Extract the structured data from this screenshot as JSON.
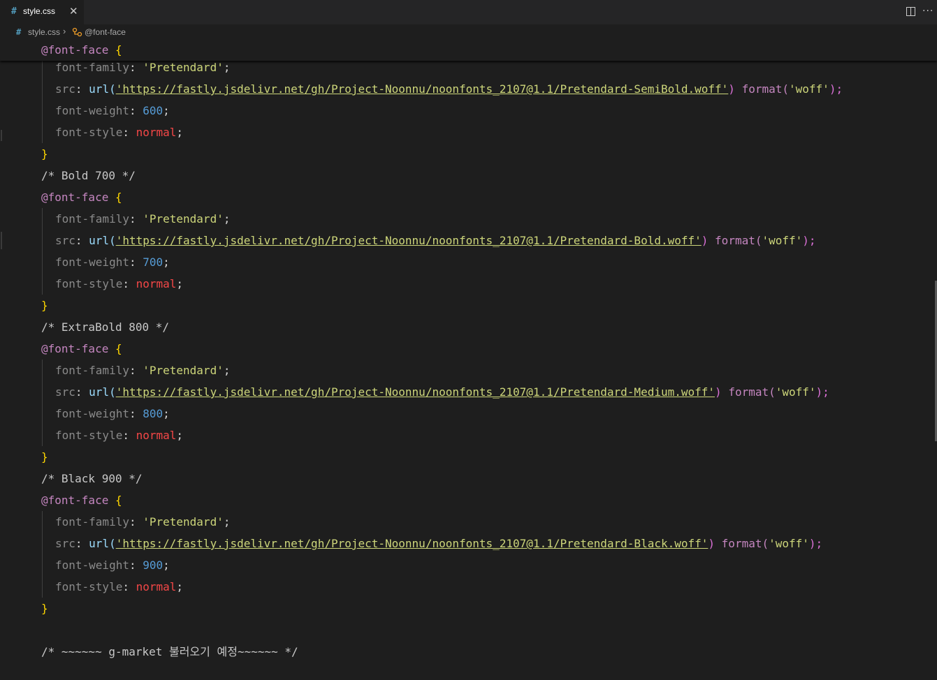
{
  "tab": {
    "icon": "#",
    "label": "style.css",
    "close": "✕"
  },
  "toolbar": {
    "split_icon": "split-editor-icon",
    "more": "···"
  },
  "breadcrumb": {
    "file_icon": "#",
    "file": "style.css",
    "separator": "›",
    "symbol": "@font-face"
  },
  "editor": {
    "sticky": {
      "at": "@font-face",
      "brace": "{"
    },
    "lines": [
      {
        "prop": "font-family",
        "value": "'Pretendard'"
      },
      {
        "prop": "src",
        "url_fn": "url(",
        "link": "'https://fastly.jsdelivr.net/gh/Project-Noonnu/noonfonts_2107@1.1/Pretendard-SemiBold.woff'",
        "close": ")",
        "fmt": "format(",
        "fmt_val": "'woff'",
        "fmt_close": ");"
      },
      {
        "prop": "font-weight",
        "value": "600"
      },
      {
        "prop": "font-style",
        "value": "normal"
      },
      {
        "close_brace": "}"
      },
      {
        "comment": "/* Bold 700 */"
      },
      {
        "at": "@font-face",
        "brace": "{"
      },
      {
        "prop": "font-family",
        "value": "'Pretendard'"
      },
      {
        "prop": "src",
        "url_fn": "url(",
        "link": "'https://fastly.jsdelivr.net/gh/Project-Noonnu/noonfonts_2107@1.1/Pretendard-Bold.woff'",
        "close": ")",
        "fmt": "format(",
        "fmt_val": "'woff'",
        "fmt_close": ");"
      },
      {
        "prop": "font-weight",
        "value": "700"
      },
      {
        "prop": "font-style",
        "value": "normal"
      },
      {
        "close_brace": "}"
      },
      {
        "comment": "/* ExtraBold 800 */"
      },
      {
        "at": "@font-face",
        "brace": "{"
      },
      {
        "prop": "font-family",
        "value": "'Pretendard'"
      },
      {
        "prop": "src",
        "url_fn": "url(",
        "link": "'https://fastly.jsdelivr.net/gh/Project-Noonnu/noonfonts_2107@1.1/Pretendard-Medium.woff'",
        "close": ")",
        "fmt": "format(",
        "fmt_val": "'woff'",
        "fmt_close": ");"
      },
      {
        "prop": "font-weight",
        "value": "800"
      },
      {
        "prop": "font-style",
        "value": "normal"
      },
      {
        "close_brace": "}"
      },
      {
        "comment": "/* Black 900 */"
      },
      {
        "at": "@font-face",
        "brace": "{"
      },
      {
        "prop": "font-family",
        "value": "'Pretendard'"
      },
      {
        "prop": "src",
        "url_fn": "url(",
        "link": "'https://fastly.jsdelivr.net/gh/Project-Noonnu/noonfonts_2107@1.1/Pretendard-Black.woff'",
        "close": ")",
        "fmt": "format(",
        "fmt_val": "'woff'",
        "fmt_close": ");"
      },
      {
        "prop": "font-weight",
        "value": "900"
      },
      {
        "prop": "font-style",
        "value": "normal"
      },
      {
        "close_brace": "}"
      },
      {
        "blank": ""
      },
      {
        "comment": "/* ~~~~~~ g-market 불러오기 예정~~~~~~ */"
      }
    ]
  }
}
